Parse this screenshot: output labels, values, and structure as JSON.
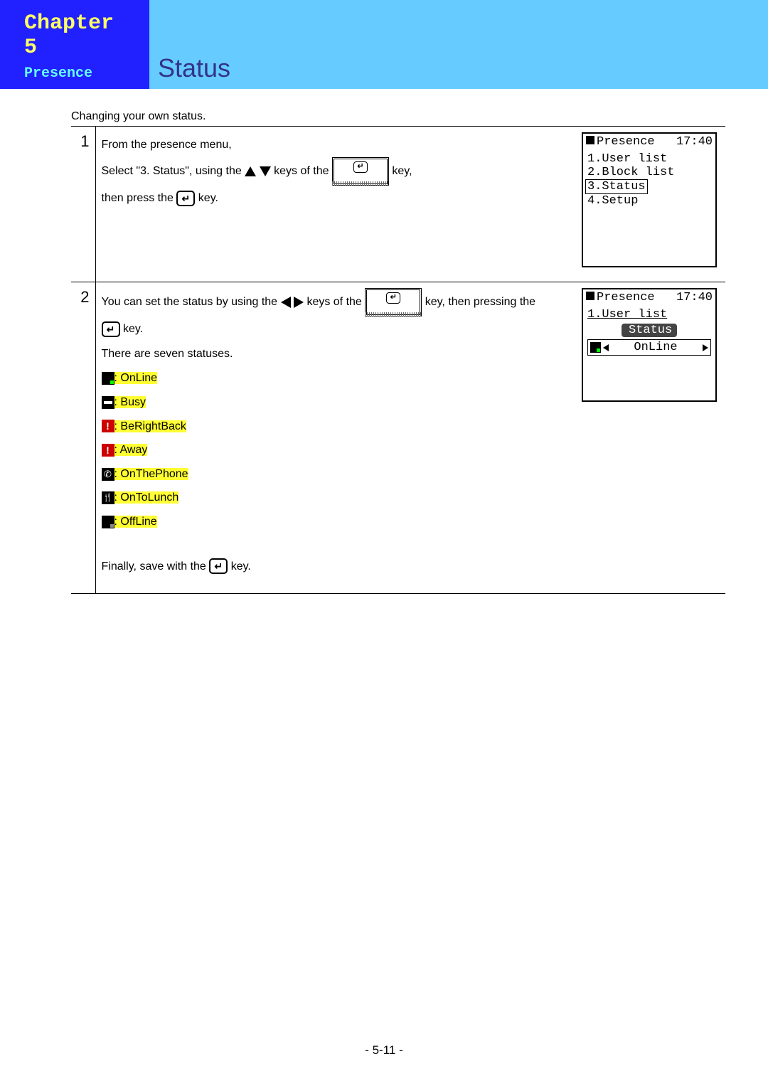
{
  "header": {
    "chapter": "Chapter 5",
    "section": "Presence",
    "title": "Status"
  },
  "caption": "Changing your own status.",
  "steps": {
    "s1": {
      "num": "1",
      "line1": "From the presence menu,",
      "line2a": "Select \"3. Status\", using the ",
      "line2b": " keys of the ",
      "line2c": " key,",
      "line3a": "then press the ",
      "line3b": " key."
    },
    "s2": {
      "num": "2",
      "line1a": "You can set the status by using the ",
      "line1b": " keys of the ",
      "line1c": " key, then pressing the",
      "line1d": " key.",
      "line2": "There are seven statuses.",
      "statuses": {
        "online": ": OnLine",
        "busy": ": Busy",
        "brb": ": BeRightBack",
        "away": ": Away",
        "phone": ": OnThePhone",
        "lunch": ": OnToLunch",
        "offline": ": OffLine"
      },
      "final_a": "Finally, save with the ",
      "final_b": " key."
    }
  },
  "lcd1": {
    "title": "Presence",
    "time": "17:40",
    "l1": "1.User list",
    "l2": "2.Block list",
    "l3": "3.Status",
    "l4": "4.Setup"
  },
  "lcd2": {
    "title": "Presence",
    "time": "17:40",
    "l1": "1.User list",
    "btn": "Status",
    "field": "OnLine"
  },
  "page": "- 5-11 -"
}
